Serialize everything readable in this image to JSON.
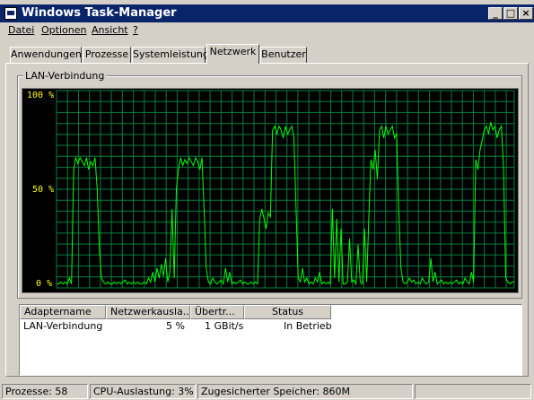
{
  "window": {
    "title": "Windows Task-Manager",
    "minimize": "_",
    "maximize": "□",
    "close": "×"
  },
  "menu": [
    {
      "label": "Datei"
    },
    {
      "label": "Optionen"
    },
    {
      "label": "Ansicht"
    },
    {
      "label": "?"
    }
  ],
  "tabs": [
    {
      "label": "Anwendungen",
      "active": false
    },
    {
      "label": "Prozesse",
      "active": false
    },
    {
      "label": "Systemleistung",
      "active": false
    },
    {
      "label": "Netzwerk",
      "active": true
    },
    {
      "label": "Benutzer",
      "active": false
    }
  ],
  "group": {
    "label": "LAN-Verbindung"
  },
  "graph": {
    "ylabels": [
      "100 %",
      "50 %",
      "0 %"
    ],
    "colors": {
      "background": "#000000",
      "grid": "#008040",
      "line": "#00ff00",
      "labels": "#ffff00"
    }
  },
  "adapters": {
    "columns": [
      "Adaptername",
      "Netzwerkausla...",
      "Übertr...",
      "Status"
    ],
    "rows": [
      {
        "name": "LAN-Verbindung",
        "usage": "5 %",
        "speed": "1 GBit/s",
        "status": "In Betrieb"
      }
    ]
  },
  "statusbar": {
    "processes": "Prozesse: 58",
    "cpu": "CPU-Auslastung: 3%",
    "memory": "Zugesicherter Speicher: 860M"
  },
  "chart_data": {
    "type": "line",
    "ylim": [
      0,
      100
    ],
    "series": [
      {
        "values": [
          2,
          2,
          3,
          2,
          3,
          2,
          5,
          2,
          60,
          66,
          63,
          66,
          64,
          62,
          66,
          60,
          64,
          62,
          66,
          50,
          20,
          5,
          3,
          2,
          3,
          2,
          2,
          3,
          2,
          3,
          2,
          3,
          4,
          2,
          3,
          2,
          3,
          2,
          3,
          2,
          2,
          3,
          2,
          5,
          3,
          8,
          3,
          10,
          5,
          12,
          6,
          15,
          3,
          8,
          40,
          5,
          50,
          60,
          66,
          62,
          65,
          63,
          66,
          64,
          62,
          66,
          64,
          60,
          66,
          40,
          10,
          3,
          2,
          5,
          3,
          2,
          3,
          4,
          2,
          10,
          3,
          8,
          2,
          3,
          2,
          3,
          4,
          2,
          3,
          2,
          2,
          3,
          2,
          3,
          2,
          35,
          40,
          35,
          30,
          38,
          36,
          80,
          82,
          78,
          82,
          80,
          76,
          82,
          78,
          80,
          82,
          76,
          40,
          5,
          3,
          10,
          3,
          5,
          2,
          3,
          2,
          5,
          3,
          8,
          2,
          3,
          2,
          3,
          2,
          40,
          5,
          35,
          3,
          30,
          2,
          2,
          3,
          25,
          3,
          4,
          2,
          22,
          3,
          2,
          30,
          3,
          35,
          65,
          60,
          70,
          55,
          80,
          82,
          76,
          82,
          78,
          80,
          82,
          76,
          78,
          40,
          10,
          3,
          2,
          3,
          5,
          3,
          4,
          2,
          3,
          2,
          5,
          3,
          2,
          3,
          15,
          3,
          8,
          2,
          3,
          4,
          2,
          3,
          2,
          3,
          2,
          3,
          4,
          2,
          3,
          2,
          5,
          3,
          2,
          8,
          3,
          65,
          60,
          70,
          75,
          80,
          82,
          78,
          84,
          80,
          82,
          76,
          80,
          82,
          60,
          5,
          3,
          2,
          3,
          3
        ]
      }
    ]
  }
}
